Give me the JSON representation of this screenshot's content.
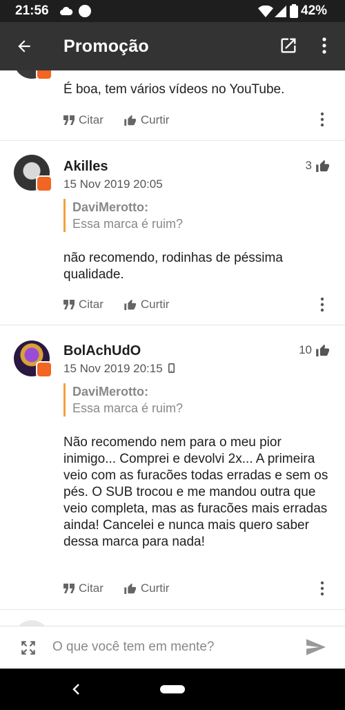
{
  "status_bar": {
    "time": "21:56",
    "battery": "42%"
  },
  "app_bar": {
    "title": "Promoção"
  },
  "comments": [
    {
      "author": "",
      "date": "",
      "text": "É boa, tem vários vídeos no YouTube.",
      "cite_label": "Citar",
      "like_label": "Curtir"
    },
    {
      "author": "Akilles",
      "date": "15 Nov 2019 20:05",
      "likes": "3",
      "quote_author": "DaviMerotto:",
      "quote_text": "Essa marca é ruim?",
      "text": "não recomendo, rodinhas de péssima qualidade.",
      "cite_label": "Citar",
      "like_label": "Curtir"
    },
    {
      "author": "BolAchUdO",
      "date": "15 Nov 2019 20:15",
      "likes": "10",
      "quote_author": "DaviMerotto:",
      "quote_text": "Essa marca é ruim?",
      "text": "Não recomendo nem para o meu pior inimigo... Comprei e devolvi 2x... A primeira veio com as furacões todas erradas e sem os pés. O SUB trocou e me mandou outra que veio completa, mas as furacões mais erradas ainda! Cancelei e nunca mais quero saber dessa marca para nada!",
      "cite_label": "Citar",
      "like_label": "Curtir"
    }
  ],
  "composer": {
    "placeholder": "O que você tem em mente?"
  },
  "colors": {
    "accent": "#f26522",
    "quote_bar": "#f0a13a",
    "app_bar": "#333333"
  }
}
